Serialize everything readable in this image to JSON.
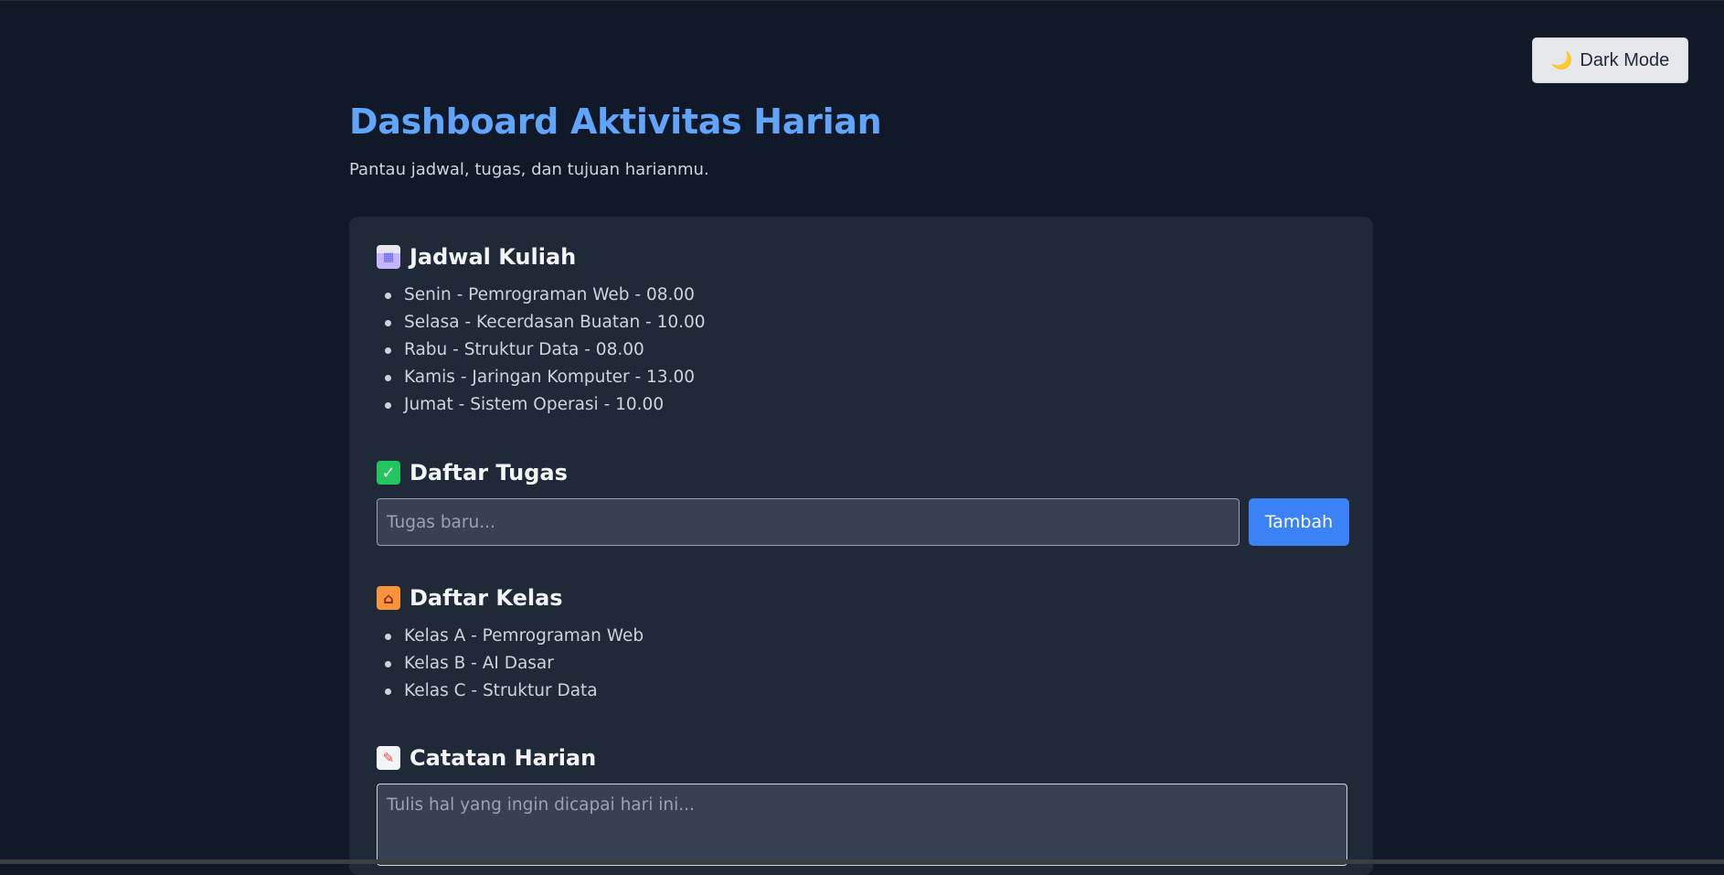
{
  "toggle": {
    "icon": "crescent-moon-icon",
    "label": "Dark Mode"
  },
  "header": {
    "title": "Dashboard Aktivitas Harian",
    "subtitle": "Pantau jadwal, tugas, dan tujuan harianmu."
  },
  "schedule": {
    "icon": "calendar-icon",
    "title": "Jadwal Kuliah",
    "items": [
      "Senin - Pemrograman Web - 08.00",
      "Selasa - Kecerdasan Buatan - 10.00",
      "Rabu - Struktur Data - 08.00",
      "Kamis - Jaringan Komputer - 13.00",
      "Jumat - Sistem Operasi - 10.00"
    ]
  },
  "tasks": {
    "icon": "check-mark-icon",
    "title": "Daftar Tugas",
    "input_value": "",
    "input_placeholder": "Tugas baru...",
    "add_label": "Tambah"
  },
  "classes": {
    "icon": "school-icon",
    "title": "Daftar Kelas",
    "items": [
      "Kelas A - Pemrograman Web",
      "Kelas B - AI Dasar",
      "Kelas C - Struktur Data"
    ]
  },
  "notes": {
    "icon": "memo-icon",
    "title": "Catatan Harian",
    "value": "",
    "placeholder": "Tulis hal yang ingin dicapai hari ini..."
  },
  "colors": {
    "background": "#111827",
    "card": "#1f2937",
    "accent": "#60a5fa",
    "button": "#3b82f6",
    "input": "#374151"
  }
}
